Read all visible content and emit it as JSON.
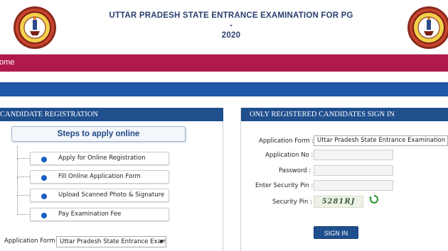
{
  "header": {
    "title_line1": "UTTAR PRADESH STATE ENTRANCE EXAMINATION FOR PG -",
    "title_line2": "2020",
    "logo_left": "university-seal",
    "logo_right": "university-seal"
  },
  "nav": {
    "home_label": "ome"
  },
  "registration": {
    "heading": "CANDIDATE REGISTRATION",
    "steps_title": "Steps to apply online",
    "steps": [
      {
        "label": "Apply for Online Registration"
      },
      {
        "label": "Fill Online Application Form"
      },
      {
        "label": "Upload Scanned Photo & Signature"
      },
      {
        "label": "Pay Examination Fee"
      }
    ],
    "application_form_label": "Application Form :",
    "application_form_value": "Uttar Pradesh State Entrance Exami"
  },
  "signin": {
    "heading": "ONLY REGISTERED CANDIDATES SIGN IN",
    "application_form_label": "Application Form :",
    "application_form_value": "Uttar Pradesh State Entrance Examination For F",
    "application_no_label": "Application No :",
    "password_label": "Password :",
    "security_pin_entry_label": "Enter Security Pin :",
    "security_pin_label": "Security Pin :",
    "captcha_text": "5281RJ",
    "button_label": "SIGN IN"
  },
  "colors": {
    "nav_bar": "#b0194e",
    "blue_bar": "#1f58a6",
    "panel_header": "#1f4f8d",
    "title_text": "#2a3f6d"
  }
}
